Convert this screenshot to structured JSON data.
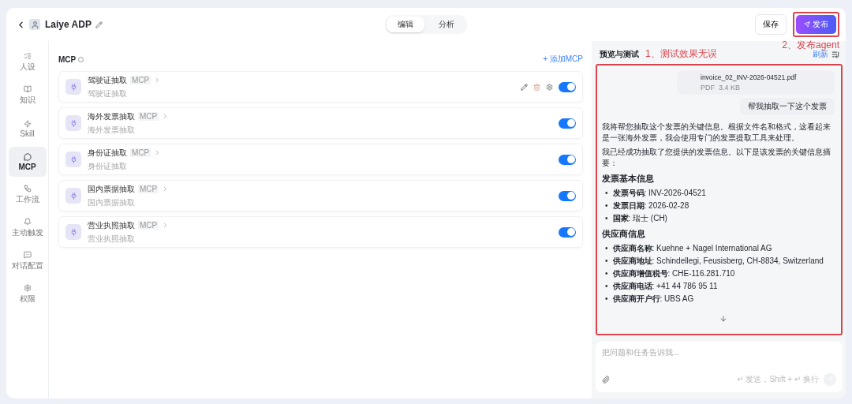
{
  "header": {
    "title": "Laiye ADP",
    "tabs": [
      {
        "label": "编辑",
        "selected": true
      },
      {
        "label": "分析",
        "selected": false
      }
    ],
    "save": "保存",
    "publish": "发布"
  },
  "annotations": {
    "publish_note": "2、发布agent",
    "preview_note": "1、测试效果无误"
  },
  "sidebar": {
    "items": [
      {
        "kind": "persona",
        "label": "人设",
        "selected": false
      },
      {
        "kind": "knowledge",
        "label": "知识",
        "selected": false
      },
      {
        "kind": "skill",
        "label": "Skill",
        "selected": false
      },
      {
        "kind": "mcp",
        "label": "MCP",
        "selected": true
      },
      {
        "kind": "workflow",
        "label": "工作流",
        "selected": false
      },
      {
        "kind": "trigger",
        "label": "主动触发",
        "selected": false
      },
      {
        "kind": "chat",
        "label": "对话配置",
        "selected": false
      },
      {
        "kind": "permission",
        "label": "权限",
        "selected": false
      }
    ]
  },
  "mcp": {
    "title": "MCP",
    "add": "+ 添加MCP",
    "items": [
      {
        "name": "驾驶证抽取",
        "tag": "MCP",
        "description": "驾驶证抽取",
        "enabled": true,
        "hovered": true
      },
      {
        "name": "海外发票抽取",
        "tag": "MCP",
        "description": "海外发票抽取",
        "enabled": true,
        "hovered": false
      },
      {
        "name": "身份证抽取",
        "tag": "MCP",
        "description": "身份证抽取",
        "enabled": true,
        "hovered": false
      },
      {
        "name": "国内票据抽取",
        "tag": "MCP",
        "description": "国内票据抽取",
        "enabled": true,
        "hovered": false
      },
      {
        "name": "营业执照抽取",
        "tag": "MCP",
        "description": "营业执照抽取",
        "enabled": true,
        "hovered": false
      }
    ]
  },
  "preview": {
    "title": "预览与测试",
    "refresh": "刷新",
    "file": {
      "name": "invoice_02_INV-2026-04521.pdf",
      "meta": "PDF  3.4 KB"
    },
    "user_message": "帮我抽取一下这个发票",
    "reply": [
      {
        "kind": "paragraph",
        "text": "我将帮您抽取这个发票的关键信息。根据文件名和格式，这看起来是一张海外发票，我会使用专门的发票提取工具来处理。"
      },
      {
        "kind": "paragraph",
        "text": "我已经成功抽取了您提供的发票信息。以下是该发票的关键信息摘要："
      },
      {
        "kind": "heading",
        "text": "发票基本信息"
      },
      {
        "kind": "list",
        "bullet": "•",
        "items": [
          "**发票号码**: INV-2026-04521",
          "**发票日期**: 2026-02-28",
          "**国家**: 瑞士 (CH)"
        ]
      },
      {
        "kind": "heading",
        "text": "供应商信息"
      },
      {
        "kind": "list",
        "bullet": "•",
        "items": [
          "**供应商名称**: Kuehne + Nagel International AG",
          "**供应商地址**: Schindellegi, Feusisberg, CH-8834, Switzerland",
          "**供应商增值税号**: CHE-116.281.710",
          "**供应商电话**: +41 44 786 95 11",
          "**供应商开户行**: UBS AG"
        ]
      }
    ],
    "input": {
      "placeholder": "把问题和任务告诉我...",
      "hint": "↵ 发送，Shift + ↵ 换行"
    }
  }
}
